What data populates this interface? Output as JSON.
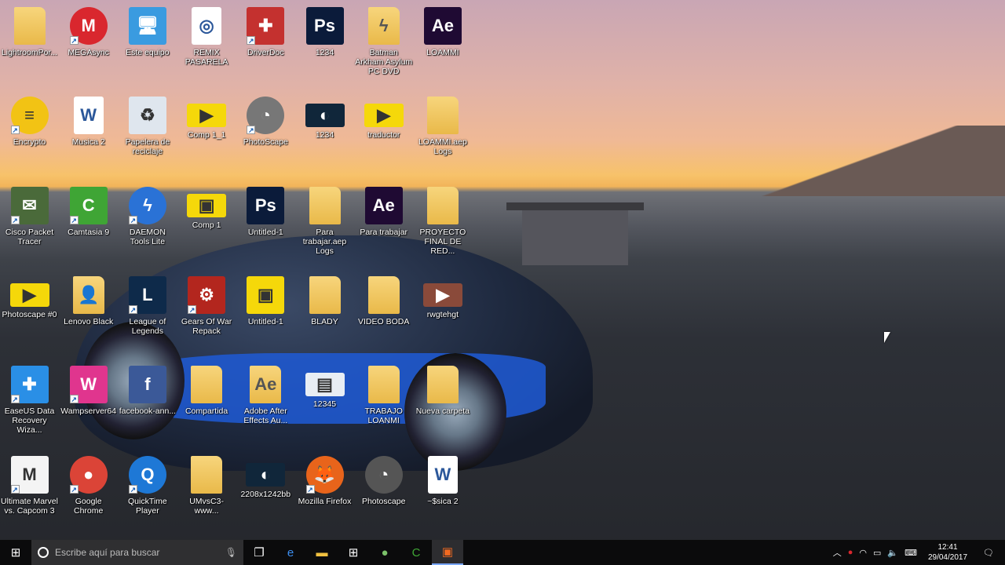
{
  "desktop": {
    "icons": [
      {
        "label": "LightroomPor...",
        "icon": "folder-icon",
        "kind": "folder",
        "glyph": "",
        "color": "",
        "shortcut": false
      },
      {
        "label": "MEGAsync",
        "icon": "mega-icon",
        "kind": "round",
        "glyph": "M",
        "color": "#d9272e",
        "shortcut": true
      },
      {
        "label": "Este equipo",
        "icon": "computer-icon",
        "kind": "box",
        "glyph": "🖥",
        "color": "#3a9be0",
        "shortcut": false
      },
      {
        "label": "REMIX PASARELA",
        "icon": "audio-file-icon",
        "kind": "doc",
        "glyph": "◎",
        "color": "",
        "shortcut": false
      },
      {
        "label": "DriverDoc",
        "icon": "driverdoc-icon",
        "kind": "box",
        "glyph": "✚",
        "color": "#c4312f",
        "shortcut": true
      },
      {
        "label": "1234",
        "icon": "photoshop-file-icon",
        "kind": "box",
        "glyph": "Ps",
        "color": "#0b1b3a",
        "shortcut": false
      },
      {
        "label": "Batman Arkham Asylum PC DVD",
        "icon": "folder-icon",
        "kind": "folder",
        "glyph": "ϟ",
        "color": "",
        "shortcut": false
      },
      {
        "label": "LOAMMI",
        "icon": "after-effects-file-icon",
        "kind": "box",
        "glyph": "Ae",
        "color": "#1f0a33",
        "shortcut": false
      },
      {
        "label": "Encrypto",
        "icon": "encrypto-icon",
        "kind": "round",
        "glyph": "≡",
        "color": "#f2c314",
        "shortcut": true
      },
      {
        "label": "Musica 2",
        "icon": "word-document-icon",
        "kind": "doc",
        "glyph": "W",
        "color": "",
        "shortcut": false
      },
      {
        "label": "Papelera de reciclaje",
        "icon": "recycle-bin-icon",
        "kind": "box",
        "glyph": "♻",
        "color": "#dfe6ee",
        "shortcut": false
      },
      {
        "label": "Comp 1_1",
        "icon": "video-file-icon",
        "kind": "thumb",
        "glyph": "▶",
        "color": "#f5d80a",
        "shortcut": false
      },
      {
        "label": "PhotoScape",
        "icon": "photoscape-icon",
        "kind": "round",
        "glyph": "◔",
        "color": "#777",
        "shortcut": true
      },
      {
        "label": "1234",
        "icon": "image-thumbnail-icon",
        "kind": "thumb",
        "glyph": "◐",
        "color": "#10263a",
        "shortcut": false
      },
      {
        "label": "traductor",
        "icon": "video-file-icon",
        "kind": "thumb",
        "glyph": "▶",
        "color": "#f5d80a",
        "shortcut": false
      },
      {
        "label": "LOAMMI.aep Logs",
        "icon": "folder-icon",
        "kind": "folder",
        "glyph": "",
        "color": "",
        "shortcut": false
      },
      {
        "label": "Cisco Packet Tracer",
        "icon": "cisco-packet-tracer-icon",
        "kind": "box",
        "glyph": "✉",
        "color": "#4a6a3a",
        "shortcut": true
      },
      {
        "label": "Camtasia 9",
        "icon": "camtasia-icon",
        "kind": "box",
        "glyph": "C",
        "color": "#3fa535",
        "shortcut": true
      },
      {
        "label": "DAEMON Tools Lite",
        "icon": "daemon-tools-icon",
        "kind": "round",
        "glyph": "ϟ",
        "color": "#2a72d6",
        "shortcut": true
      },
      {
        "label": "Comp 1",
        "icon": "image-file-icon",
        "kind": "thumb",
        "glyph": "▣",
        "color": "#f5d80a",
        "shortcut": false
      },
      {
        "label": "Untitled-1",
        "icon": "photoshop-file-icon",
        "kind": "box",
        "glyph": "Ps",
        "color": "#0b1b3a",
        "shortcut": false
      },
      {
        "label": "Para trabajar.aep Logs",
        "icon": "folder-icon",
        "kind": "folder",
        "glyph": "",
        "color": "",
        "shortcut": false
      },
      {
        "label": "Para trabajar",
        "icon": "after-effects-file-icon",
        "kind": "box",
        "glyph": "Ae",
        "color": "#1f0a33",
        "shortcut": false
      },
      {
        "label": "PROYECTO FINAL DE RED...",
        "icon": "folder-icon",
        "kind": "folder",
        "glyph": "",
        "color": "",
        "shortcut": false
      },
      {
        "label": "Photoscape #0",
        "icon": "video-file-icon",
        "kind": "thumb",
        "glyph": "▶",
        "color": "#f5d80a",
        "shortcut": false
      },
      {
        "label": "Lenovo Black",
        "icon": "user-folder-icon",
        "kind": "folder",
        "glyph": "👤",
        "color": "",
        "shortcut": false
      },
      {
        "label": "League of Legends",
        "icon": "league-of-legends-icon",
        "kind": "box",
        "glyph": "L",
        "color": "#0e2a4a",
        "shortcut": true
      },
      {
        "label": "Gears Of War Repack",
        "icon": "gears-of-war-icon",
        "kind": "box",
        "glyph": "⚙",
        "color": "#b3261e",
        "shortcut": true
      },
      {
        "label": "Untitled-1",
        "icon": "image-file-icon",
        "kind": "box",
        "glyph": "▣",
        "color": "#f5d80a",
        "shortcut": false
      },
      {
        "label": "BLADY",
        "icon": "folder-icon",
        "kind": "folder",
        "glyph": "",
        "color": "",
        "shortcut": false
      },
      {
        "label": "VIDEO BODA",
        "icon": "folder-icon",
        "kind": "folder",
        "glyph": "",
        "color": "",
        "shortcut": false
      },
      {
        "label": "rwgtehgt",
        "icon": "video-thumbnail-icon",
        "kind": "thumb",
        "glyph": "▶",
        "color": "#8a4a3a",
        "shortcut": false
      },
      {
        "label": "EaseUS Data Recovery Wiza...",
        "icon": "easeus-icon",
        "kind": "box",
        "glyph": "✚",
        "color": "#2a8fe6",
        "shortcut": true
      },
      {
        "label": "Wampserver64",
        "icon": "wampserver-icon",
        "kind": "box",
        "glyph": "W",
        "color": "#e0358e",
        "shortcut": true
      },
      {
        "label": "facebook-ann...",
        "icon": "facebook-icon",
        "kind": "box",
        "glyph": "f",
        "color": "#3b5998",
        "shortcut": false
      },
      {
        "label": "Compartida",
        "icon": "folder-icon",
        "kind": "folder",
        "glyph": "",
        "color": "",
        "shortcut": false
      },
      {
        "label": "Adobe After Effects Au...",
        "icon": "folder-icon",
        "kind": "folder",
        "glyph": "Ae",
        "color": "",
        "shortcut": false
      },
      {
        "label": "12345",
        "icon": "image-thumbnail-icon",
        "kind": "thumb",
        "glyph": "▤",
        "color": "#e8eef4",
        "shortcut": false
      },
      {
        "label": "TRABAJO LOANMI",
        "icon": "folder-icon",
        "kind": "folder",
        "glyph": "",
        "color": "",
        "shortcut": false
      },
      {
        "label": "Nueva carpeta",
        "icon": "folder-icon",
        "kind": "folder",
        "glyph": "",
        "color": "",
        "shortcut": false
      },
      {
        "label": "Ultimate Marvel vs. Capcom 3",
        "icon": "marvel-capcom-icon",
        "kind": "box",
        "glyph": "M",
        "color": "#f4f4f4",
        "shortcut": true
      },
      {
        "label": "Google Chrome",
        "icon": "chrome-icon",
        "kind": "round",
        "glyph": "●",
        "color": "#db4437",
        "shortcut": true
      },
      {
        "label": "QuickTime Player",
        "icon": "quicktime-icon",
        "kind": "round",
        "glyph": "Q",
        "color": "#1e78d6",
        "shortcut": true
      },
      {
        "label": "UMvsC3-www...",
        "icon": "folder-icon",
        "kind": "folder",
        "glyph": "",
        "color": "",
        "shortcut": false
      },
      {
        "label": "2208x1242bb",
        "icon": "image-thumbnail-icon",
        "kind": "thumb",
        "glyph": "◐",
        "color": "#10263a",
        "shortcut": false
      },
      {
        "label": "Mozilla Firefox",
        "icon": "firefox-icon",
        "kind": "round",
        "glyph": "🦊",
        "color": "#e8641b",
        "shortcut": true
      },
      {
        "label": "Photoscape",
        "icon": "photoscape-icon",
        "kind": "round",
        "glyph": "◔",
        "color": "#555",
        "shortcut": false
      },
      {
        "label": "~$sica 2",
        "icon": "word-document-icon",
        "kind": "doc",
        "glyph": "W",
        "color": "",
        "shortcut": false
      }
    ]
  },
  "taskbar": {
    "search_placeholder": "Escribe aquí para buscar",
    "apps": [
      {
        "name": "task-view-button",
        "glyph": "❐",
        "color": "#fff"
      },
      {
        "name": "edge-button",
        "glyph": "e",
        "color": "#3c8ef0"
      },
      {
        "name": "file-explorer-button",
        "glyph": "▬",
        "color": "#f0c040"
      },
      {
        "name": "store-button",
        "glyph": "⊞",
        "color": "#fff"
      },
      {
        "name": "maps-button",
        "glyph": "●",
        "color": "#7cc26a"
      },
      {
        "name": "camtasia-button",
        "glyph": "C",
        "color": "#3fa535"
      },
      {
        "name": "camtasia-recorder-button",
        "glyph": "▣",
        "color": "#f26a21"
      }
    ],
    "time": "12:41",
    "date": "29/04/2017"
  }
}
